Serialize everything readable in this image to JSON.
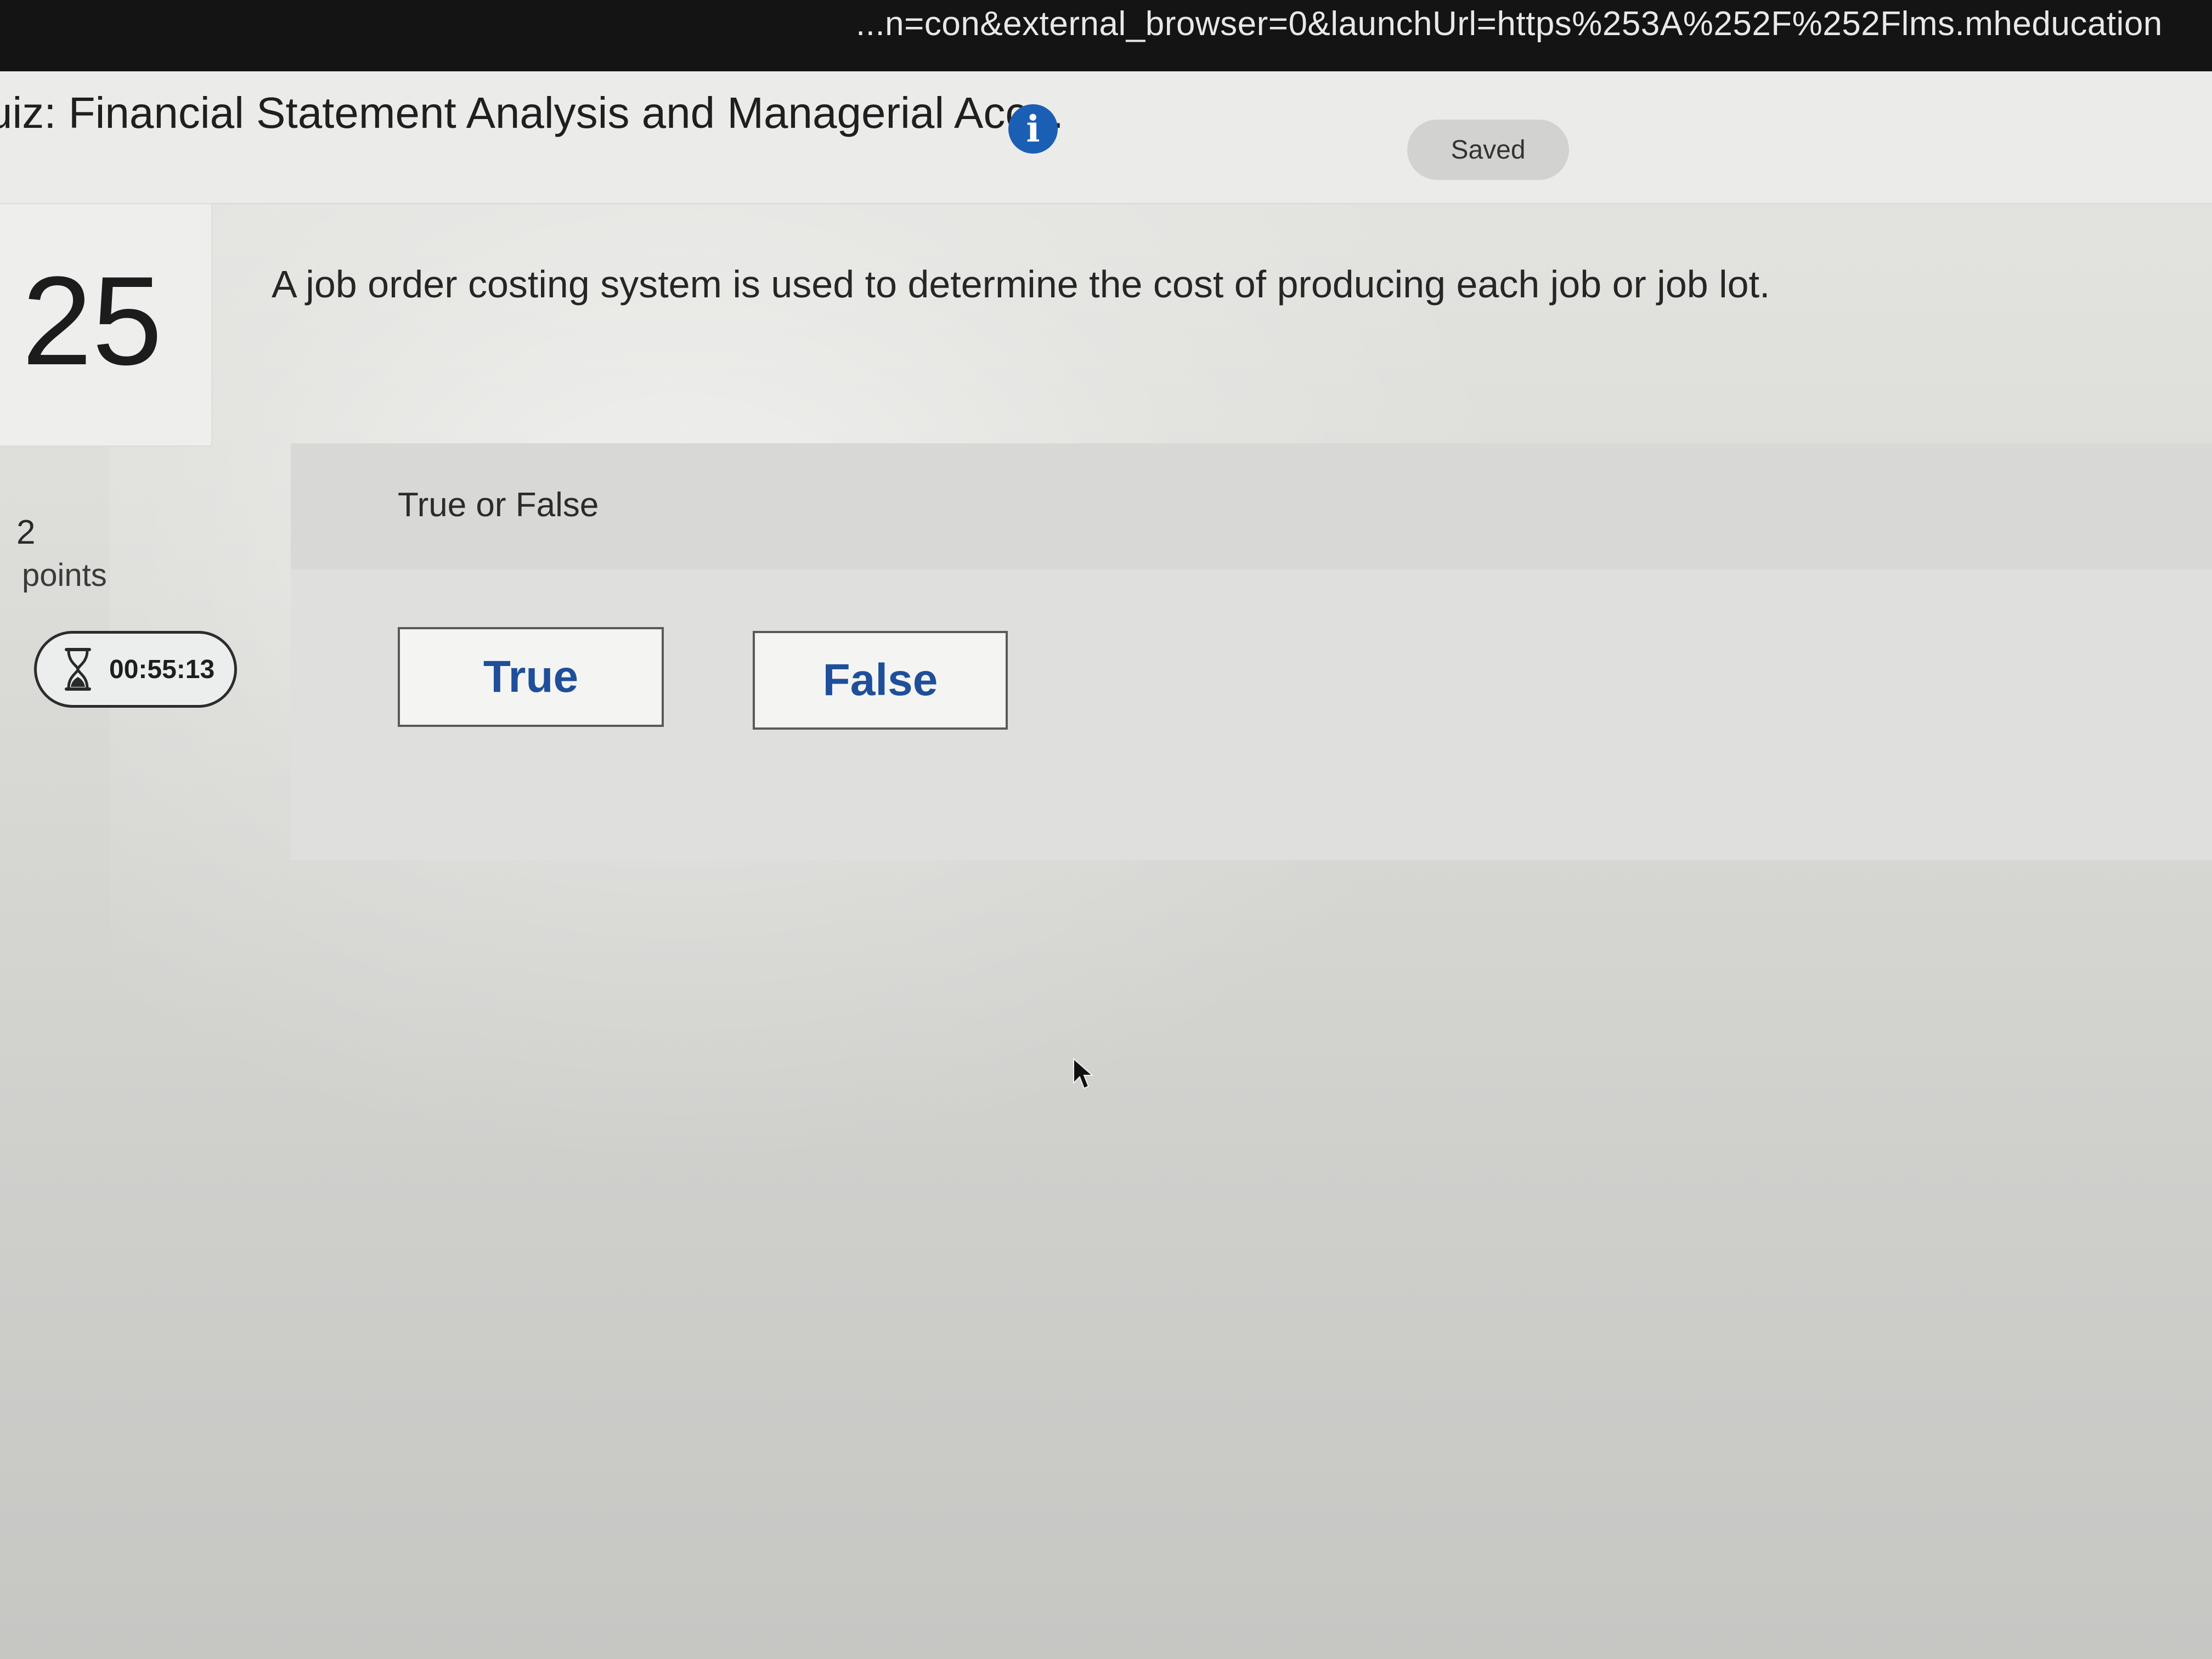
{
  "browser": {
    "url_fragment": "...n=con&external_browser=0&launchUrl=https%253A%252F%252Flms.mheducation"
  },
  "header": {
    "quiz_title": "uiz: Financial Statement Analysis and Managerial Acc...",
    "saved_label": "Saved"
  },
  "question": {
    "number": "25",
    "prompt": "A job order costing system is used to determine the cost of producing each job or job lot.",
    "points_value": "2",
    "points_label": "points",
    "type_label": "True or False",
    "choices": [
      {
        "label": "True"
      },
      {
        "label": "False"
      }
    ]
  },
  "timer": {
    "remaining": "00:55:13"
  },
  "icons": {
    "info": "info-icon",
    "timer": "hourglass-icon",
    "cursor": "mouse-pointer-icon"
  },
  "colors": {
    "accent": "#1a5fb4",
    "button_text": "#1f4f9a"
  }
}
